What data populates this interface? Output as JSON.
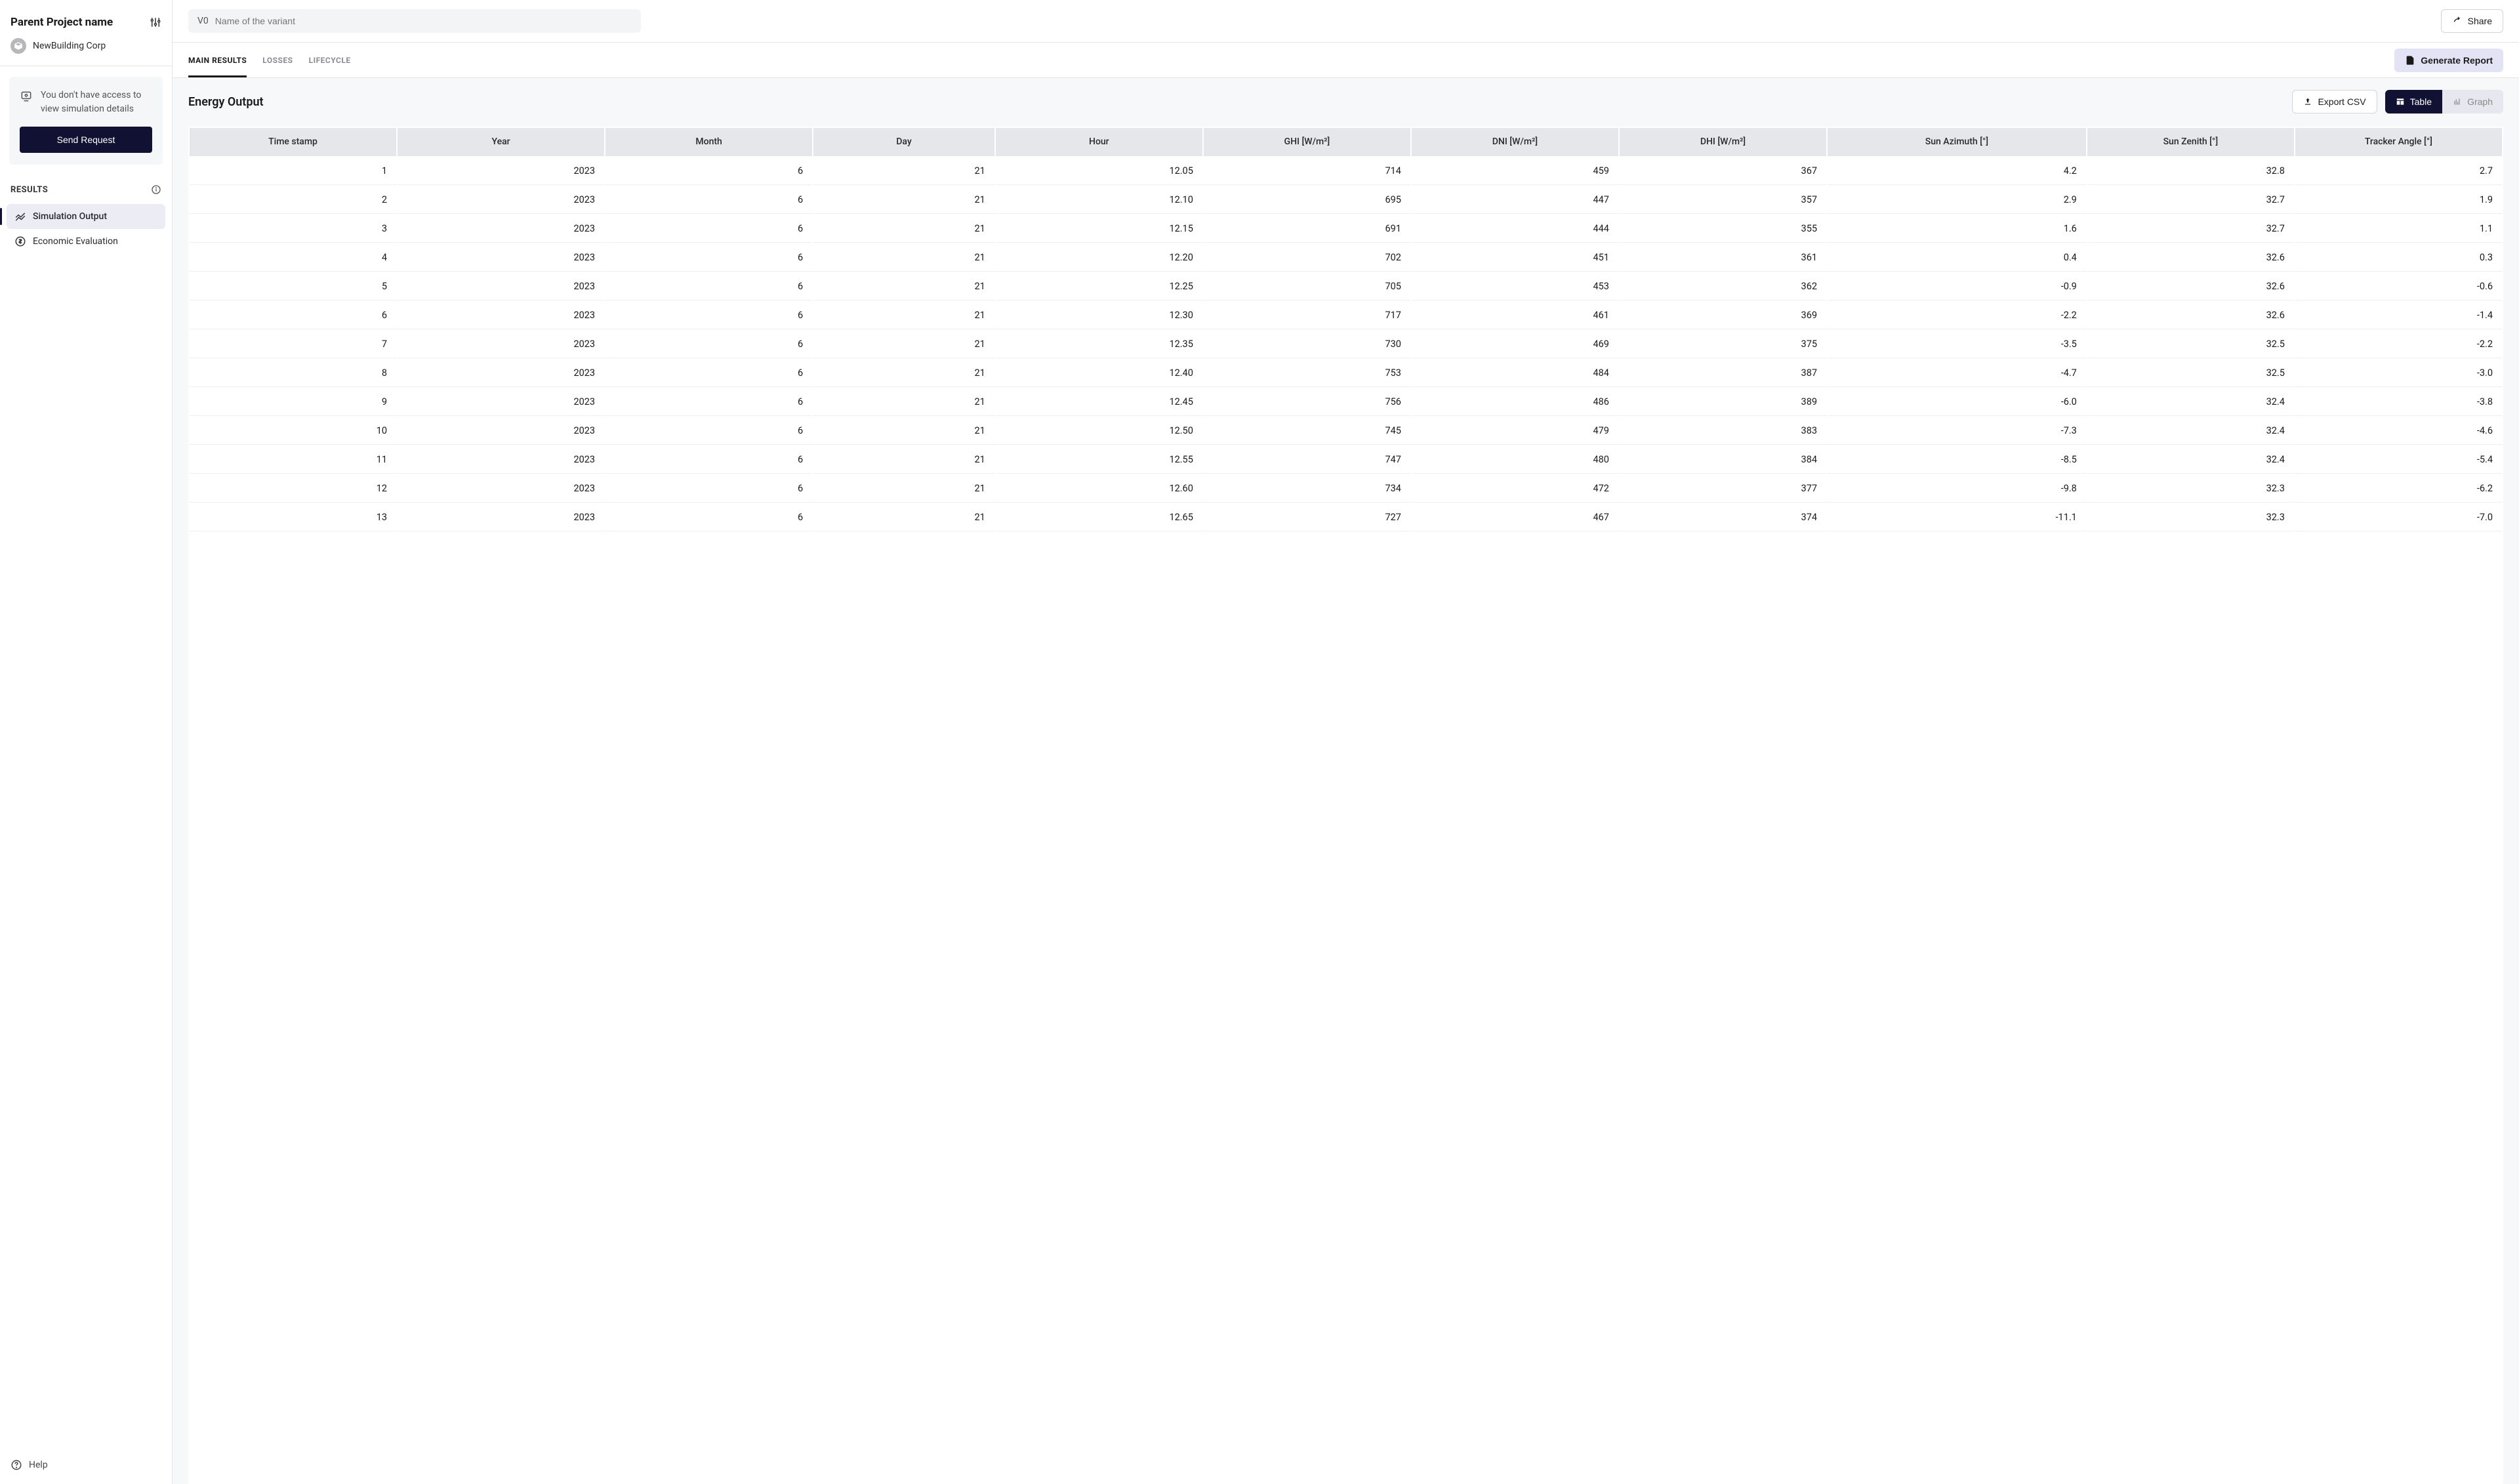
{
  "sidebar": {
    "project_name": "Parent Project name",
    "org_name": "NewBuilding Corp",
    "access_notice": "You don't have access to view simulation details",
    "send_request_label": "Send Request",
    "section_title": "RESULTS",
    "nav": [
      {
        "label": "Simulation Output",
        "active": true
      },
      {
        "label": "Economic Evaluation",
        "active": false
      }
    ],
    "help_label": "Help"
  },
  "topbar": {
    "variant_prefix": "V0",
    "variant_placeholder": "Name of the variant",
    "share_label": "Share"
  },
  "subbar": {
    "tabs": [
      {
        "label": "MAIN RESULTS",
        "active": true
      },
      {
        "label": "LOSSES",
        "active": false
      },
      {
        "label": "LIFECYCLE",
        "active": false
      }
    ],
    "generate_label": "Generate Report"
  },
  "content": {
    "title": "Energy Output",
    "export_label": "Export CSV",
    "toggle_table": "Table",
    "toggle_graph": "Graph",
    "table": {
      "headers": [
        "Time stamp",
        "Year",
        "Month",
        "Day",
        "Hour",
        "GHI [W/m²]",
        "DNI [W/m²]",
        "DHI [W/m²]",
        "Sun Azimuth [°]",
        "Sun Zenith [°]",
        "Tracker Angle [°]"
      ],
      "rows": [
        [
          "1",
          "2023",
          "6",
          "21",
          "12.05",
          "714",
          "459",
          "367",
          "4.2",
          "32.8",
          "2.7"
        ],
        [
          "2",
          "2023",
          "6",
          "21",
          "12.10",
          "695",
          "447",
          "357",
          "2.9",
          "32.7",
          "1.9"
        ],
        [
          "3",
          "2023",
          "6",
          "21",
          "12.15",
          "691",
          "444",
          "355",
          "1.6",
          "32.7",
          "1.1"
        ],
        [
          "4",
          "2023",
          "6",
          "21",
          "12.20",
          "702",
          "451",
          "361",
          "0.4",
          "32.6",
          "0.3"
        ],
        [
          "5",
          "2023",
          "6",
          "21",
          "12.25",
          "705",
          "453",
          "362",
          "-0.9",
          "32.6",
          "-0.6"
        ],
        [
          "6",
          "2023",
          "6",
          "21",
          "12.30",
          "717",
          "461",
          "369",
          "-2.2",
          "32.6",
          "-1.4"
        ],
        [
          "7",
          "2023",
          "6",
          "21",
          "12.35",
          "730",
          "469",
          "375",
          "-3.5",
          "32.5",
          "-2.2"
        ],
        [
          "8",
          "2023",
          "6",
          "21",
          "12.40",
          "753",
          "484",
          "387",
          "-4.7",
          "32.5",
          "-3.0"
        ],
        [
          "9",
          "2023",
          "6",
          "21",
          "12.45",
          "756",
          "486",
          "389",
          "-6.0",
          "32.4",
          "-3.8"
        ],
        [
          "10",
          "2023",
          "6",
          "21",
          "12.50",
          "745",
          "479",
          "383",
          "-7.3",
          "32.4",
          "-4.6"
        ],
        [
          "11",
          "2023",
          "6",
          "21",
          "12.55",
          "747",
          "480",
          "384",
          "-8.5",
          "32.4",
          "-5.4"
        ],
        [
          "12",
          "2023",
          "6",
          "21",
          "12.60",
          "734",
          "472",
          "377",
          "-9.8",
          "32.3",
          "-6.2"
        ],
        [
          "13",
          "2023",
          "6",
          "21",
          "12.65",
          "727",
          "467",
          "374",
          "-11.1",
          "32.3",
          "-7.0"
        ]
      ]
    }
  }
}
